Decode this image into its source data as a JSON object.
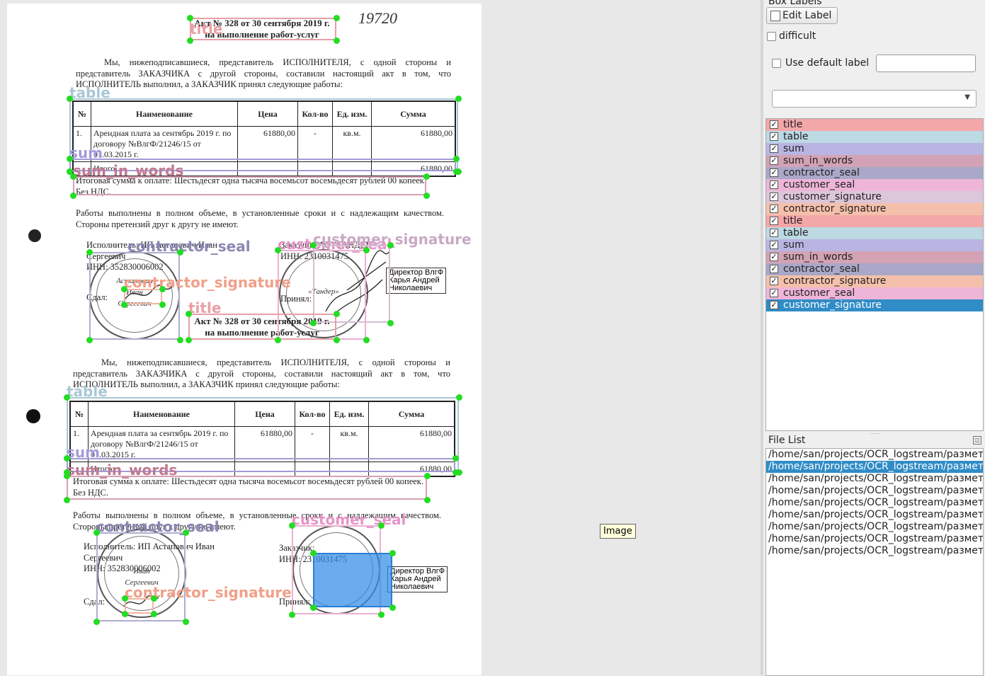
{
  "canvas": {
    "tooltip": "Image",
    "handwritten_number": "19720",
    "documents": [
      {
        "title_line1": "Акт № 328 от 30 сентября 2019 г.",
        "title_line2": "на выполнение работ-услуг",
        "intro": "Мы, нижеподписавшиеся, представитель ИСПОЛНИТЕЛЯ, с одной стороны и представитель ЗАКАЗЧИКА с другой стороны, составили настоящий акт в том, что ИСПОЛНИТЕЛЬ выполнил, а ЗАКАЗЧИК принял следующие работы:",
        "sum_in_words": "Итоговая сумма к оплате: Шестьдесят одна тысяча восемьсот восемьдесят рублей 00 копеек. Без НДС.",
        "completion": "Работы выполнены в полном объеме, в установленные сроки и с надлежащим качеством. Стороны претензий друг к другу не имеют.",
        "contractor_line1": "Исполнитель: ИП Астапович Иван",
        "contractor_line2": "Сергеевич",
        "contractor_inn": "ИНН: 352830006002",
        "contractor_sign": "Сдал:",
        "customer_line1": "Заказчик: АО \"ТАНДЕР\"",
        "customer_inn": "ИНН: 2310031475",
        "customer_sign": "Принял:",
        "stamp_line1": "Директор ВлгФ",
        "stamp_line2": "Карья Андрей",
        "stamp_line3": "Николаевич"
      },
      {
        "title_line1": "Акт № 328 от 30 сентября 2019 г.",
        "title_line2": "на выполнение работ-услуг",
        "intro": "Мы, нижеподписавшиеся, представитель ИСПОЛНИТЕЛЯ, с одной стороны и представитель ЗАКАЗЧИКА с другой стороны, составили настоящий акт в том, что ИСПОЛНИТЕЛЬ выполнил, а ЗАКАЗЧИК принял следующие работы:",
        "sum_in_words": "Итоговая сумма к оплате: Шестьдесят одна тысяча восемьсот восемьдесят рублей 00 копеек. Без НДС.",
        "completion": "Работы выполнены в полном объеме, в установленные сроки и с надлежащим качеством. Стороны претензий друг к другу не имеют.",
        "contractor_line1": "Исполнитель: ИП Астапович Иван",
        "contractor_line2": "Сергеевич",
        "contractor_inn": "ИНН: 352830006002",
        "contractor_sign": "Сдал:",
        "customer_line1": "Заказчик: АО \"ТАНДЕР\"",
        "customer_inn": "ИНН: 2310031475",
        "customer_sign": "Принял:",
        "stamp_line1": "Директор ВлгФ",
        "stamp_line2": "Карья Андрей",
        "stamp_line3": "Николаевич"
      }
    ],
    "table": {
      "headers": [
        "№",
        "Наименование",
        "Цена",
        "Кол-во",
        "Ед. изм.",
        "Сумма"
      ],
      "row": [
        "1.",
        "Арендная плата за сентябрь 2019 г. по договору №ВлгФ/21246/15 от 01.03.2015 г.",
        "61880,00",
        "-",
        "кв.м.",
        "61880,00"
      ],
      "total_label": "Итого:",
      "total_value": "61880,00"
    },
    "seal_text": {
      "contractor_name1": "Астапович",
      "contractor_name2": "Иван",
      "contractor_name3": "Сергеевич",
      "customer_name": "«Тандер»"
    },
    "annotations": [
      {
        "label": "title",
        "color": "#e8717a"
      },
      {
        "label": "table",
        "color": "#a9c7d6"
      },
      {
        "label": "sum",
        "color": "#a39ad8"
      },
      {
        "label": "sum_in_words",
        "color": "#c07a90"
      },
      {
        "label": "contractor_seal",
        "color": "#8a88b5"
      },
      {
        "label": "customer_seal",
        "color": "#e694c8"
      },
      {
        "label": "customer_signature",
        "color": "#c9a9c4"
      },
      {
        "label": "contractor_signature",
        "color": "#f0a089"
      }
    ]
  },
  "panel": {
    "box_labels_title": "Box Labels",
    "edit_label_button": "Edit Label",
    "difficult_label": "difficult",
    "use_default_label": "Use default label",
    "default_label_value": "",
    "label_combo_value": "",
    "labels": [
      {
        "text": "title",
        "color": "#f4a7a9",
        "checked": true
      },
      {
        "text": "table",
        "color": "#bcd9e4",
        "checked": true
      },
      {
        "text": "sum",
        "color": "#b9b5e3",
        "checked": true
      },
      {
        "text": "sum_in_words",
        "color": "#d3a3b5",
        "checked": true
      },
      {
        "text": "contractor_seal",
        "color": "#a9a8c8",
        "checked": true
      },
      {
        "text": "customer_seal",
        "color": "#eeb5d8",
        "checked": true
      },
      {
        "text": "customer_signature",
        "color": "#dcc6d9",
        "checked": true
      },
      {
        "text": "contractor_signature",
        "color": "#f5c0ab",
        "checked": true
      },
      {
        "text": "title",
        "color": "#f4a7a9",
        "checked": true
      },
      {
        "text": "table",
        "color": "#bcd9e4",
        "checked": true
      },
      {
        "text": "sum",
        "color": "#b9b5e3",
        "checked": true
      },
      {
        "text": "sum_in_words",
        "color": "#d3a3b5",
        "checked": true
      },
      {
        "text": "contractor_seal",
        "color": "#a9a8c8",
        "checked": true
      },
      {
        "text": "contractor_signature",
        "color": "#f5c0ab",
        "checked": true
      },
      {
        "text": "customer_seal",
        "color": "#eeb5d8",
        "checked": true
      },
      {
        "text": "customer_signature",
        "color": "#308cc6",
        "checked": true,
        "selected": true
      }
    ],
    "file_list_title": "File List",
    "files": [
      "/home/san/projects/OCR_logstream/размет",
      "/home/san/projects/OCR_logstream/размет",
      "/home/san/projects/OCR_logstream/размет",
      "/home/san/projects/OCR_logstream/размет",
      "/home/san/projects/OCR_logstream/размет",
      "/home/san/projects/OCR_logstream/размет",
      "/home/san/projects/OCR_logstream/размет",
      "/home/san/projects/OCR_logstream/размет",
      "/home/san/projects/OCR_logstream/размет"
    ],
    "selected_file_index": 1
  }
}
